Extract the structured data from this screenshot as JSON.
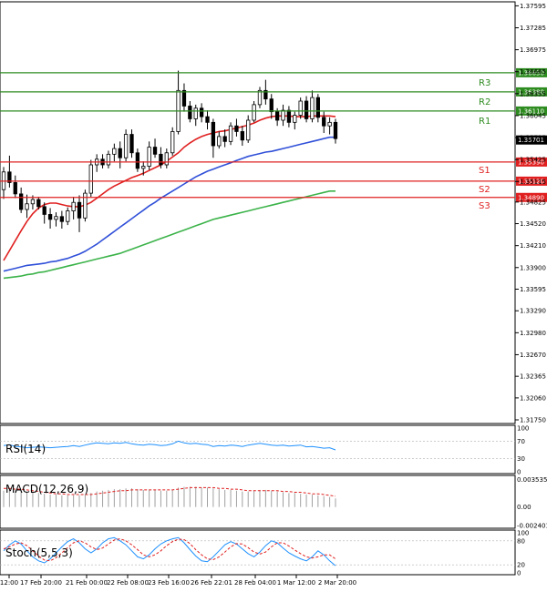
{
  "chart_data": [
    {
      "type": "candlestick",
      "panel": "price",
      "y_ticks": [
        "1.37595",
        "1.37285",
        "1.36975",
        "1.36665",
        "1.36355",
        "1.36045",
        "1.35735",
        "1.35425",
        "1.35115",
        "1.34825",
        "1.34520",
        "1.34210",
        "1.33900",
        "1.33595",
        "1.33290",
        "1.32980",
        "1.32670",
        "1.32365",
        "1.32060",
        "1.31750"
      ],
      "ylim": [
        1.3175,
        1.376
      ],
      "x_ticks": [
        "12:00",
        "17 Feb 20:00",
        "21 Feb 00:00",
        "22 Feb 08:00",
        "23 Feb 16:00",
        "26 Feb 22:01",
        "28 Feb 04:00",
        "1 Mar 12:00",
        "2 Mar 20:00"
      ],
      "current_price": "1.35701",
      "levels": [
        {
          "name": "R3",
          "value": "1.36650",
          "color": "#2e8b20"
        },
        {
          "name": "R2",
          "value": "1.36380",
          "color": "#2e8b20"
        },
        {
          "name": "R1",
          "value": "1.36110",
          "color": "#2e8b20"
        },
        {
          "name": "S1",
          "value": "1.35390",
          "color": "#e02020"
        },
        {
          "name": "S2",
          "value": "1.35120",
          "color": "#e02020"
        },
        {
          "name": "S3",
          "value": "1.34890",
          "color": "#e02020"
        }
      ],
      "candles": [
        [
          1.35,
          1.3532,
          1.3487,
          1.3525
        ],
        [
          1.3525,
          1.3548,
          1.3503,
          1.351
        ],
        [
          1.351,
          1.352,
          1.3488,
          1.3494
        ],
        [
          1.3494,
          1.3503,
          1.3467,
          1.3472
        ],
        [
          1.3472,
          1.3493,
          1.346,
          1.348
        ],
        [
          1.348,
          1.3492,
          1.3472,
          1.3486
        ],
        [
          1.3486,
          1.349,
          1.3472,
          1.3476
        ],
        [
          1.3476,
          1.3482,
          1.3452,
          1.3465
        ],
        [
          1.3465,
          1.3474,
          1.3445,
          1.3458
        ],
        [
          1.3458,
          1.3468,
          1.3448,
          1.3462
        ],
        [
          1.3462,
          1.347,
          1.3445,
          1.3455
        ],
        [
          1.3455,
          1.3475,
          1.345,
          1.347
        ],
        [
          1.347,
          1.349,
          1.3458,
          1.3482
        ],
        [
          1.3482,
          1.3492,
          1.344,
          1.346
        ],
        [
          1.346,
          1.35,
          1.3455,
          1.3495
        ],
        [
          1.3495,
          1.3542,
          1.349,
          1.3535
        ],
        [
          1.3535,
          1.355,
          1.3525,
          1.3543
        ],
        [
          1.3543,
          1.355,
          1.353,
          1.3535
        ],
        [
          1.3535,
          1.3555,
          1.353,
          1.355
        ],
        [
          1.355,
          1.3565,
          1.354,
          1.3558
        ],
        [
          1.3558,
          1.3568,
          1.353,
          1.3545
        ],
        [
          1.3545,
          1.3585,
          1.354,
          1.3578
        ],
        [
          1.3578,
          1.3585,
          1.3545,
          1.3552
        ],
        [
          1.3552,
          1.3558,
          1.3525,
          1.353
        ],
        [
          1.353,
          1.354,
          1.352,
          1.3533
        ],
        [
          1.3533,
          1.3568,
          1.3528,
          1.356
        ],
        [
          1.356,
          1.3572,
          1.3545,
          1.355
        ],
        [
          1.355,
          1.356,
          1.353,
          1.3535
        ],
        [
          1.3535,
          1.3558,
          1.353,
          1.3552
        ],
        [
          1.3552,
          1.3588,
          1.3548,
          1.3582
        ],
        [
          1.3582,
          1.3668,
          1.3578,
          1.364
        ],
        [
          1.364,
          1.365,
          1.361,
          1.3618
        ],
        [
          1.3618,
          1.3625,
          1.3595,
          1.36
        ],
        [
          1.36,
          1.362,
          1.359,
          1.3615
        ],
        [
          1.3615,
          1.3622,
          1.3595,
          1.3603
        ],
        [
          1.3603,
          1.3612,
          1.3585,
          1.3595
        ],
        [
          1.3595,
          1.36,
          1.3545,
          1.3562
        ],
        [
          1.3562,
          1.3582,
          1.3558,
          1.3575
        ],
        [
          1.3575,
          1.3585,
          1.356,
          1.3568
        ],
        [
          1.3568,
          1.3595,
          1.3563,
          1.359
        ],
        [
          1.359,
          1.36,
          1.3575,
          1.3582
        ],
        [
          1.3582,
          1.359,
          1.3562,
          1.357
        ],
        [
          1.357,
          1.3605,
          1.3566,
          1.3598
        ],
        [
          1.3598,
          1.3625,
          1.3595,
          1.362
        ],
        [
          1.362,
          1.3645,
          1.3615,
          1.364
        ],
        [
          1.364,
          1.3655,
          1.362,
          1.3628
        ],
        [
          1.3628,
          1.3635,
          1.36,
          1.361
        ],
        [
          1.361,
          1.3615,
          1.359,
          1.3598
        ],
        [
          1.3598,
          1.362,
          1.359,
          1.3612
        ],
        [
          1.3612,
          1.3618,
          1.3588,
          1.3595
        ],
        [
          1.3595,
          1.361,
          1.3585,
          1.3605
        ],
        [
          1.3605,
          1.363,
          1.36,
          1.3625
        ],
        [
          1.3625,
          1.3632,
          1.3595,
          1.36
        ],
        [
          1.36,
          1.364,
          1.3595,
          1.363
        ],
        [
          1.363,
          1.3635,
          1.3595,
          1.3602
        ],
        [
          1.3602,
          1.361,
          1.358,
          1.359
        ],
        [
          1.359,
          1.3602,
          1.3578,
          1.3595
        ],
        [
          1.3595,
          1.36,
          1.3565,
          1.3572
        ]
      ],
      "ma_fast": [
        1.34,
        1.3414,
        1.3428,
        1.3442,
        1.3455,
        1.3466,
        1.3474,
        1.3479,
        1.3481,
        1.3481,
        1.3479,
        1.3477,
        1.3476,
        1.3476,
        1.3478,
        1.3482,
        1.3488,
        1.3494,
        1.35,
        1.3505,
        1.3509,
        1.3513,
        1.3517,
        1.352,
        1.3523,
        1.3527,
        1.3531,
        1.3535,
        1.354,
        1.3546,
        1.3552,
        1.356,
        1.3566,
        1.3571,
        1.3575,
        1.3578,
        1.358,
        1.3582,
        1.3583,
        1.3585,
        1.3587,
        1.3589,
        1.3591,
        1.3594,
        1.3598,
        1.3601,
        1.3603,
        1.3604,
        1.3604,
        1.3604,
        1.3603,
        1.3603,
        1.3603,
        1.3604,
        1.3604,
        1.3604,
        1.3604,
        1.3603
      ],
      "ma_mid": [
        1.3385,
        1.3387,
        1.3389,
        1.3391,
        1.3393,
        1.3394,
        1.3395,
        1.3396,
        1.3398,
        1.3399,
        1.3401,
        1.3403,
        1.3406,
        1.3409,
        1.3413,
        1.3418,
        1.3423,
        1.3429,
        1.3435,
        1.3441,
        1.3447,
        1.3453,
        1.3459,
        1.3465,
        1.3471,
        1.3477,
        1.3482,
        1.3488,
        1.3493,
        1.3498,
        1.3503,
        1.3508,
        1.3513,
        1.3518,
        1.3522,
        1.3526,
        1.3529,
        1.3532,
        1.3535,
        1.3538,
        1.3541,
        1.3544,
        1.3547,
        1.3549,
        1.3551,
        1.3553,
        1.3554,
        1.3556,
        1.3558,
        1.356,
        1.3562,
        1.3564,
        1.3566,
        1.3568,
        1.357,
        1.3572,
        1.3574,
        1.3574
      ],
      "ma_slow": [
        1.3375,
        1.3376,
        1.3377,
        1.3378,
        1.338,
        1.3381,
        1.3383,
        1.3384,
        1.3386,
        1.3388,
        1.339,
        1.3392,
        1.3394,
        1.3396,
        1.3398,
        1.34,
        1.3402,
        1.3404,
        1.3406,
        1.3408,
        1.341,
        1.3413,
        1.3416,
        1.3419,
        1.3422,
        1.3425,
        1.3428,
        1.3431,
        1.3434,
        1.3437,
        1.344,
        1.3443,
        1.3446,
        1.3449,
        1.3452,
        1.3455,
        1.3458,
        1.346,
        1.3462,
        1.3464,
        1.3466,
        1.3468,
        1.347,
        1.3472,
        1.3474,
        1.3476,
        1.3478,
        1.348,
        1.3482,
        1.3484,
        1.3486,
        1.3488,
        1.349,
        1.3492,
        1.3494,
        1.3496,
        1.3498,
        1.3498
      ]
    },
    {
      "type": "line",
      "panel": "rsi",
      "label": "RSI(14)",
      "y_ticks": [
        "100",
        "70",
        "30",
        "0"
      ],
      "ylim": [
        0,
        100
      ],
      "values": [
        60,
        62,
        58,
        57,
        55,
        56,
        57,
        56,
        55,
        56,
        57,
        58,
        60,
        58,
        61,
        64,
        66,
        65,
        64,
        66,
        65,
        67,
        64,
        62,
        61,
        63,
        62,
        60,
        61,
        64,
        70,
        66,
        64,
        65,
        63,
        62,
        58,
        60,
        59,
        61,
        60,
        58,
        61,
        63,
        65,
        63,
        61,
        60,
        61,
        59,
        60,
        61,
        57,
        58,
        56,
        54,
        55,
        50
      ]
    },
    {
      "type": "bar",
      "panel": "macd",
      "label": "MACD(12,26,9)",
      "y_ticks": [
        "0.003535",
        "0.00",
        "-0.002401"
      ],
      "ylim": [
        -0.0025,
        0.0036
      ],
      "values": [
        0.0021,
        0.0022,
        0.0022,
        0.0021,
        0.002,
        0.0019,
        0.0018,
        0.0017,
        0.0016,
        0.0016,
        0.0015,
        0.0015,
        0.0015,
        0.0015,
        0.0016,
        0.0018,
        0.002,
        0.0021,
        0.0022,
        0.0023,
        0.0023,
        0.0024,
        0.0024,
        0.0023,
        0.0022,
        0.0022,
        0.0022,
        0.0021,
        0.0021,
        0.0022,
        0.0025,
        0.0026,
        0.0026,
        0.0026,
        0.0025,
        0.0025,
        0.0024,
        0.0023,
        0.0022,
        0.0022,
        0.0021,
        0.002,
        0.002,
        0.0021,
        0.0022,
        0.0022,
        0.0021,
        0.002,
        0.0019,
        0.0018,
        0.0018,
        0.0017,
        0.0016,
        0.0016,
        0.0015,
        0.0014,
        0.0013,
        0.0011
      ],
      "signal": [
        0.0024,
        0.0024,
        0.0023,
        0.0023,
        0.0022,
        0.0021,
        0.002,
        0.0019,
        0.0018,
        0.0017,
        0.0017,
        0.0016,
        0.0016,
        0.0016,
        0.0016,
        0.0016,
        0.0017,
        0.0018,
        0.0019,
        0.002,
        0.0021,
        0.0021,
        0.0022,
        0.0022,
        0.0022,
        0.0022,
        0.0022,
        0.0022,
        0.0022,
        0.0022,
        0.0023,
        0.0024,
        0.0025,
        0.0025,
        0.0025,
        0.0025,
        0.0025,
        0.0024,
        0.0024,
        0.0023,
        0.0023,
        0.0022,
        0.0021,
        0.0021,
        0.0021,
        0.0021,
        0.0021,
        0.0021,
        0.002,
        0.002,
        0.0019,
        0.0019,
        0.0018,
        0.0017,
        0.0017,
        0.0016,
        0.0015,
        0.0014
      ]
    },
    {
      "type": "line",
      "panel": "stoch",
      "label": "Stoch(5,5,3)",
      "y_ticks": [
        "100",
        "80",
        "20",
        "0"
      ],
      "ylim": [
        0,
        100
      ],
      "main": [
        55,
        70,
        80,
        72,
        55,
        40,
        30,
        25,
        35,
        50,
        65,
        78,
        85,
        75,
        60,
        50,
        60,
        75,
        85,
        88,
        80,
        70,
        55,
        40,
        35,
        45,
        60,
        72,
        80,
        85,
        88,
        75,
        58,
        42,
        30,
        28,
        40,
        55,
        70,
        78,
        72,
        60,
        48,
        40,
        52,
        68,
        80,
        75,
        62,
        50,
        42,
        35,
        30,
        40,
        55,
        45,
        30,
        18
      ],
      "signal": [
        60,
        65,
        72,
        75,
        68,
        55,
        42,
        32,
        30,
        38,
        50,
        63,
        75,
        80,
        75,
        65,
        58,
        62,
        72,
        82,
        85,
        80,
        70,
        58,
        45,
        40,
        45,
        55,
        68,
        78,
        84,
        83,
        73,
        58,
        45,
        35,
        33,
        40,
        52,
        65,
        73,
        72,
        63,
        52,
        47,
        52,
        65,
        75,
        75,
        67,
        57,
        48,
        40,
        37,
        40,
        45,
        45,
        35
      ]
    }
  ]
}
